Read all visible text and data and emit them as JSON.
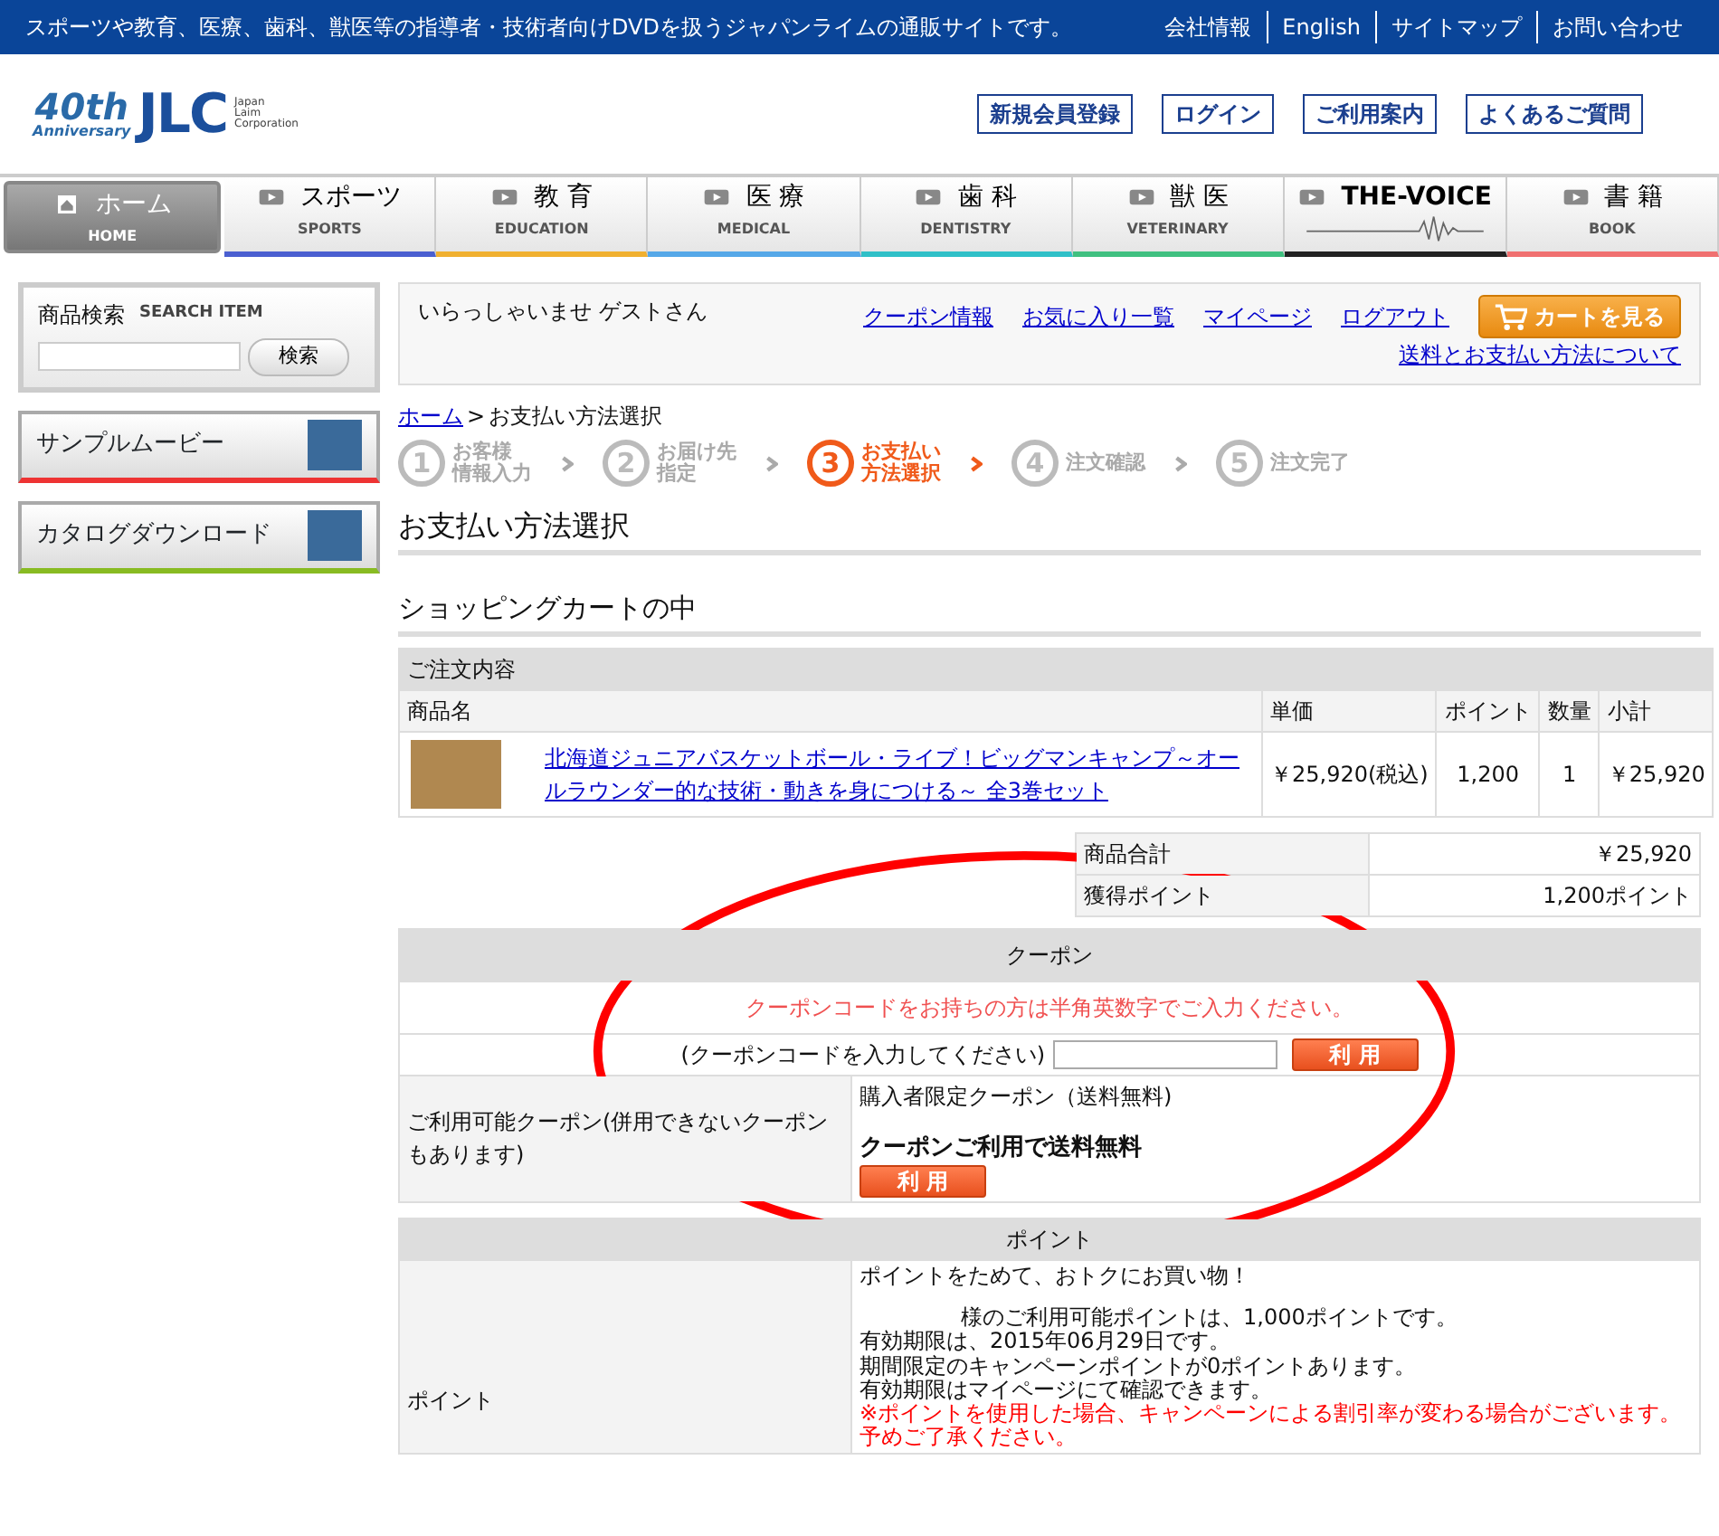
{
  "top_bar": {
    "tagline": "スポーツや教育、医療、歯科、獣医等の指導者・技術者向けDVDを扱うジャパンライムの通販サイトです。",
    "links": [
      "会社情報",
      "English",
      "サイトマップ",
      "お問い合わせ"
    ]
  },
  "logo": {
    "badge": "40th",
    "badge_sub": "Anniversary",
    "mark": "JLC",
    "company": [
      "Japan",
      "Laim",
      "Corporation"
    ]
  },
  "header_links": [
    "新規会員登録",
    "ログイン",
    "ご利用案内",
    "よくあるご質問"
  ],
  "nav": [
    {
      "kind": "home",
      "label": "ホーム",
      "sub": "HOME",
      "selected": true,
      "color": "#888888"
    },
    {
      "kind": "video",
      "label": "スポーツ",
      "sub": "SPORTS",
      "selected": false,
      "color": "#4a5fd0"
    },
    {
      "kind": "video",
      "label": "教 育",
      "sub": "EDUCATION",
      "selected": false,
      "color": "#f0b030"
    },
    {
      "kind": "video",
      "label": "医 療",
      "sub": "MEDICAL",
      "selected": false,
      "color": "#55a8e8"
    },
    {
      "kind": "video",
      "label": "歯 科",
      "sub": "DENTISTRY",
      "selected": false,
      "color": "#30c0c8"
    },
    {
      "kind": "video",
      "label": "獣 医",
      "sub": "VETERINARY",
      "selected": false,
      "color": "#40c080"
    },
    {
      "kind": "voice",
      "label": "THE-VOICE",
      "selected": false,
      "color": "#222222"
    },
    {
      "kind": "video",
      "label": "書 籍",
      "sub": "BOOK",
      "selected": false,
      "color": "#f07070"
    }
  ],
  "sidebar": {
    "search": {
      "title": "商品検索",
      "subtitle": "SEARCH ITEM",
      "button": "検索"
    },
    "banners": [
      {
        "label": "サンプルムービー",
        "color": "#ee3333"
      },
      {
        "label": "カタログダウンロード",
        "color": "#88bb22"
      }
    ]
  },
  "welcome": {
    "greeting": "いらっしゃいませ  ゲストさん",
    "links": [
      "クーポン情報",
      "お気に入り一覧",
      "マイページ",
      "ログアウト"
    ],
    "cart_button": "カートを見る",
    "shipping_link": "送料とお支払い方法について"
  },
  "breadcrumb": {
    "home": "ホーム",
    "separator": ">",
    "current": "お支払い方法選択"
  },
  "steps": [
    {
      "number": "1",
      "label": [
        "お客様",
        "情報入力"
      ],
      "selected": false
    },
    {
      "number": "2",
      "label": [
        "お届け先",
        "指定"
      ],
      "selected": false
    },
    {
      "number": "3",
      "label": [
        "お支払い",
        "方法選択"
      ],
      "selected": true
    },
    {
      "number": "4",
      "label": [
        "注文確認"
      ],
      "selected": false
    },
    {
      "number": "5",
      "label": [
        "注文完了"
      ],
      "selected": false
    }
  ],
  "page_title": "お支払い方法選択",
  "cart": {
    "title": "ショッピングカートの中",
    "caption": "ご注文内容",
    "columns": [
      "商品名",
      "単価",
      "ポイント",
      "数量",
      "小計"
    ],
    "rows": [
      {
        "name": "北海道ジュニアバスケットボール・ライブ！ビッグマンキャンプ～オールラウンダー的な技術・動きを身につける～ 全3巻セット",
        "price": "￥25,920(税込)",
        "points": "1,200",
        "quantity": "1",
        "subtotal": "￥25,920"
      }
    ],
    "summary": [
      {
        "label": "商品合計",
        "value": "￥25,920"
      },
      {
        "label": "獲得ポイント",
        "value": "1,200ポイント"
      }
    ]
  },
  "coupon": {
    "header": "クーポン",
    "notice": "クーポンコードをお持ちの方は半角英数字でご入力ください。",
    "input_label": "(クーポンコードを入力してください)",
    "apply_button": "利 用",
    "available_label": "ご利用可能クーポン(併用できないクーポンもあります)",
    "available_name": "購入者限定クーポン（送料無料)",
    "available_title": "クーポンご利用で送料無料",
    "available_button": "利 用"
  },
  "points": {
    "header": "ポイント",
    "label": "ポイント",
    "lines": [
      {
        "kind": "lead",
        "text": "ポイントをためて、おトクにお買い物！"
      },
      {
        "kind": "indented",
        "text": "様のご利用可能ポイントは、1,000ポイントです。"
      },
      {
        "kind": "text",
        "text": "有効期限は、2015年06月29日です。"
      },
      {
        "kind": "text",
        "text": "期間限定のキャンペーンポイントが0ポイントあります。"
      },
      {
        "kind": "text",
        "text": "有効期限はマイページにて確認できます。"
      },
      {
        "kind": "warning",
        "text": "※ポイントを使用した場合、キャンペーンによる割引率が変わる場合がございます。予めご了承ください。"
      }
    ]
  }
}
